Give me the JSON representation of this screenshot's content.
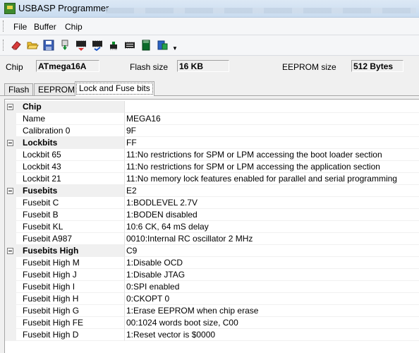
{
  "window": {
    "title": "USBASP Programmer"
  },
  "menu": {
    "items": [
      "File",
      "Buffer",
      "Chip"
    ]
  },
  "toolbar": {
    "icons": [
      "eraser-icon",
      "open-folder-icon",
      "save-icon",
      "read-chip-icon",
      "write-chip-icon",
      "verify-chip-icon",
      "chip-icon",
      "read-fuses-icon",
      "memory-card-icon",
      "settings-icon"
    ]
  },
  "info": {
    "chip_label": "Chip",
    "chip_value": "ATmega16A",
    "flash_label": "Flash size",
    "flash_value": "16 KB",
    "eeprom_label": "EEPROM size",
    "eeprom_value": "512 Bytes"
  },
  "tabs": [
    "Flash",
    "EEPROM",
    "Lock and Fuse bits"
  ],
  "grid": {
    "rows": [
      {
        "type": "category",
        "name": "Chip",
        "value": ""
      },
      {
        "type": "property",
        "name": "Name",
        "value": "MEGA16"
      },
      {
        "type": "property",
        "name": "Calibration 0",
        "value": "9F"
      },
      {
        "type": "category",
        "name": "Lockbits",
        "value": "FF"
      },
      {
        "type": "property",
        "name": "Lockbit 65",
        "value": "11:No restrictions for SPM or LPM accessing the boot loader section"
      },
      {
        "type": "property",
        "name": "Lockbit 43",
        "value": "11:No restrictions for SPM or LPM accessing the application section"
      },
      {
        "type": "property",
        "name": "Lockbit 21",
        "value": "11:No memory lock features enabled for parallel and serial programming"
      },
      {
        "type": "category",
        "name": "Fusebits",
        "value": "E2"
      },
      {
        "type": "property",
        "name": "Fusebit C",
        "value": "1:BODLEVEL 2.7V"
      },
      {
        "type": "property",
        "name": "Fusebit B",
        "value": "1:BODEN disabled"
      },
      {
        "type": "property",
        "name": "Fusebit KL",
        "value": "10:6 CK, 64 mS delay"
      },
      {
        "type": "property",
        "name": "Fusebit A987",
        "value": "0010:Internal RC oscillator 2 MHz"
      },
      {
        "type": "category",
        "name": "Fusebits High",
        "value": "C9"
      },
      {
        "type": "property",
        "name": "Fusebit High M",
        "value": "1:Disable OCD"
      },
      {
        "type": "property",
        "name": "Fusebit High J",
        "value": "1:Disable JTAG"
      },
      {
        "type": "property",
        "name": "Fusebit High I",
        "value": "0:SPI enabled"
      },
      {
        "type": "property",
        "name": "Fusebit High H",
        "value": "0:CKOPT 0"
      },
      {
        "type": "property",
        "name": "Fusebit High G",
        "value": "1:Erase EEPROM when chip erase"
      },
      {
        "type": "property",
        "name": "Fusebit High FE",
        "value": "00:1024 words boot size, C00"
      },
      {
        "type": "property",
        "name": "Fusebit High D",
        "value": "1:Reset vector is $0000"
      }
    ]
  }
}
